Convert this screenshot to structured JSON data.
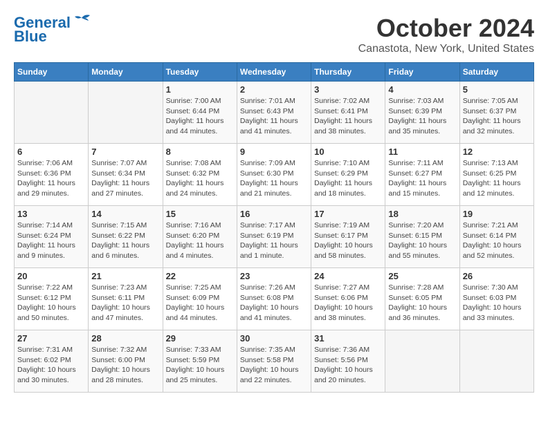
{
  "header": {
    "logo_line1": "General",
    "logo_line2": "Blue",
    "month": "October 2024",
    "location": "Canastota, New York, United States"
  },
  "weekdays": [
    "Sunday",
    "Monday",
    "Tuesday",
    "Wednesday",
    "Thursday",
    "Friday",
    "Saturday"
  ],
  "weeks": [
    [
      {
        "day": "",
        "info": ""
      },
      {
        "day": "",
        "info": ""
      },
      {
        "day": "1",
        "info": "Sunrise: 7:00 AM\nSunset: 6:44 PM\nDaylight: 11 hours and 44 minutes."
      },
      {
        "day": "2",
        "info": "Sunrise: 7:01 AM\nSunset: 6:43 PM\nDaylight: 11 hours and 41 minutes."
      },
      {
        "day": "3",
        "info": "Sunrise: 7:02 AM\nSunset: 6:41 PM\nDaylight: 11 hours and 38 minutes."
      },
      {
        "day": "4",
        "info": "Sunrise: 7:03 AM\nSunset: 6:39 PM\nDaylight: 11 hours and 35 minutes."
      },
      {
        "day": "5",
        "info": "Sunrise: 7:05 AM\nSunset: 6:37 PM\nDaylight: 11 hours and 32 minutes."
      }
    ],
    [
      {
        "day": "6",
        "info": "Sunrise: 7:06 AM\nSunset: 6:36 PM\nDaylight: 11 hours and 29 minutes."
      },
      {
        "day": "7",
        "info": "Sunrise: 7:07 AM\nSunset: 6:34 PM\nDaylight: 11 hours and 27 minutes."
      },
      {
        "day": "8",
        "info": "Sunrise: 7:08 AM\nSunset: 6:32 PM\nDaylight: 11 hours and 24 minutes."
      },
      {
        "day": "9",
        "info": "Sunrise: 7:09 AM\nSunset: 6:30 PM\nDaylight: 11 hours and 21 minutes."
      },
      {
        "day": "10",
        "info": "Sunrise: 7:10 AM\nSunset: 6:29 PM\nDaylight: 11 hours and 18 minutes."
      },
      {
        "day": "11",
        "info": "Sunrise: 7:11 AM\nSunset: 6:27 PM\nDaylight: 11 hours and 15 minutes."
      },
      {
        "day": "12",
        "info": "Sunrise: 7:13 AM\nSunset: 6:25 PM\nDaylight: 11 hours and 12 minutes."
      }
    ],
    [
      {
        "day": "13",
        "info": "Sunrise: 7:14 AM\nSunset: 6:24 PM\nDaylight: 11 hours and 9 minutes."
      },
      {
        "day": "14",
        "info": "Sunrise: 7:15 AM\nSunset: 6:22 PM\nDaylight: 11 hours and 6 minutes."
      },
      {
        "day": "15",
        "info": "Sunrise: 7:16 AM\nSunset: 6:20 PM\nDaylight: 11 hours and 4 minutes."
      },
      {
        "day": "16",
        "info": "Sunrise: 7:17 AM\nSunset: 6:19 PM\nDaylight: 11 hours and 1 minute."
      },
      {
        "day": "17",
        "info": "Sunrise: 7:19 AM\nSunset: 6:17 PM\nDaylight: 10 hours and 58 minutes."
      },
      {
        "day": "18",
        "info": "Sunrise: 7:20 AM\nSunset: 6:15 PM\nDaylight: 10 hours and 55 minutes."
      },
      {
        "day": "19",
        "info": "Sunrise: 7:21 AM\nSunset: 6:14 PM\nDaylight: 10 hours and 52 minutes."
      }
    ],
    [
      {
        "day": "20",
        "info": "Sunrise: 7:22 AM\nSunset: 6:12 PM\nDaylight: 10 hours and 50 minutes."
      },
      {
        "day": "21",
        "info": "Sunrise: 7:23 AM\nSunset: 6:11 PM\nDaylight: 10 hours and 47 minutes."
      },
      {
        "day": "22",
        "info": "Sunrise: 7:25 AM\nSunset: 6:09 PM\nDaylight: 10 hours and 44 minutes."
      },
      {
        "day": "23",
        "info": "Sunrise: 7:26 AM\nSunset: 6:08 PM\nDaylight: 10 hours and 41 minutes."
      },
      {
        "day": "24",
        "info": "Sunrise: 7:27 AM\nSunset: 6:06 PM\nDaylight: 10 hours and 38 minutes."
      },
      {
        "day": "25",
        "info": "Sunrise: 7:28 AM\nSunset: 6:05 PM\nDaylight: 10 hours and 36 minutes."
      },
      {
        "day": "26",
        "info": "Sunrise: 7:30 AM\nSunset: 6:03 PM\nDaylight: 10 hours and 33 minutes."
      }
    ],
    [
      {
        "day": "27",
        "info": "Sunrise: 7:31 AM\nSunset: 6:02 PM\nDaylight: 10 hours and 30 minutes."
      },
      {
        "day": "28",
        "info": "Sunrise: 7:32 AM\nSunset: 6:00 PM\nDaylight: 10 hours and 28 minutes."
      },
      {
        "day": "29",
        "info": "Sunrise: 7:33 AM\nSunset: 5:59 PM\nDaylight: 10 hours and 25 minutes."
      },
      {
        "day": "30",
        "info": "Sunrise: 7:35 AM\nSunset: 5:58 PM\nDaylight: 10 hours and 22 minutes."
      },
      {
        "day": "31",
        "info": "Sunrise: 7:36 AM\nSunset: 5:56 PM\nDaylight: 10 hours and 20 minutes."
      },
      {
        "day": "",
        "info": ""
      },
      {
        "day": "",
        "info": ""
      }
    ]
  ]
}
